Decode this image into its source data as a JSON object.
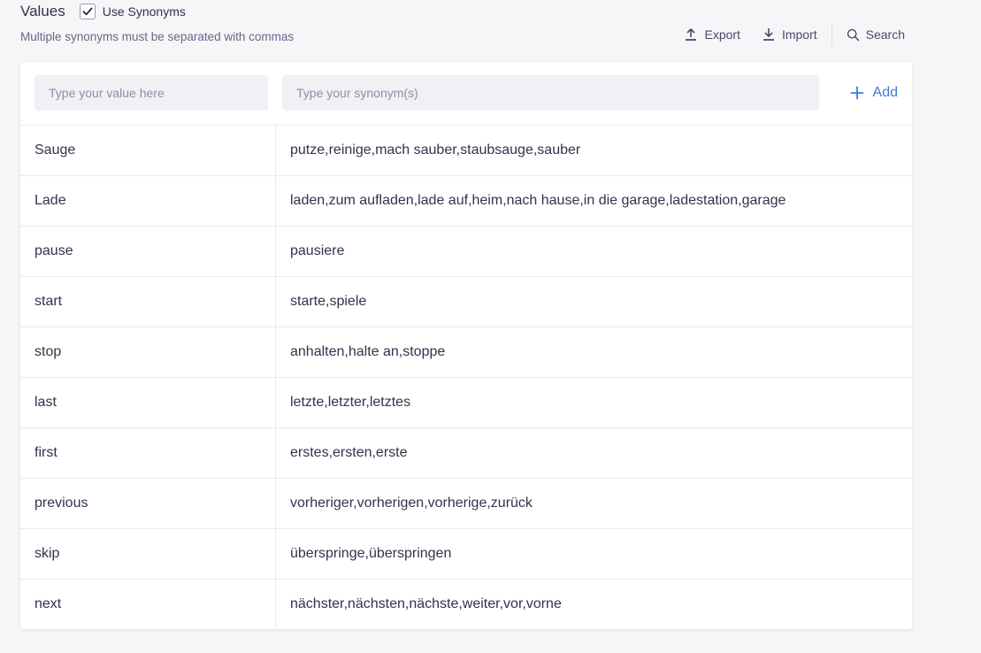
{
  "header": {
    "title": "Values",
    "use_synonyms_label": "Use Synonyms",
    "use_synonyms_checked": true,
    "subtitle": "Multiple synonyms must be separated with commas"
  },
  "actions": {
    "export_label": "Export",
    "import_label": "Import",
    "search_label": "Search"
  },
  "form": {
    "value_placeholder": "Type your value here",
    "synonym_placeholder": "Type your synonym(s)",
    "add_label": "Add"
  },
  "rows": [
    {
      "value": "Sauge",
      "synonyms": "putze,reinige,mach sauber,staubsauge,sauber"
    },
    {
      "value": "Lade",
      "synonyms": "laden,zum aufladen,lade auf,heim,nach hause,in die garage,ladestation,garage"
    },
    {
      "value": "pause",
      "synonyms": "pausiere"
    },
    {
      "value": "start",
      "synonyms": "starte,spiele"
    },
    {
      "value": "stop",
      "synonyms": "anhalten,halte an,stoppe"
    },
    {
      "value": "last",
      "synonyms": "letzte,letzter,letztes"
    },
    {
      "value": "first",
      "synonyms": "erstes,ersten,erste"
    },
    {
      "value": "previous",
      "synonyms": "vorheriger,vorherigen,vorherige,zurück"
    },
    {
      "value": "skip",
      "synonyms": "überspringe,überspringen"
    },
    {
      "value": "next",
      "synonyms": "nächster,nächsten,nächste,weiter,vor,vorne"
    }
  ],
  "colors": {
    "accent": "#3a7bd5",
    "text": "#32324d",
    "muted": "#666687"
  },
  "icons": {
    "checkbox": "check-icon",
    "export": "upload-icon",
    "import": "download-icon",
    "search": "search-icon",
    "add": "plus-icon"
  }
}
